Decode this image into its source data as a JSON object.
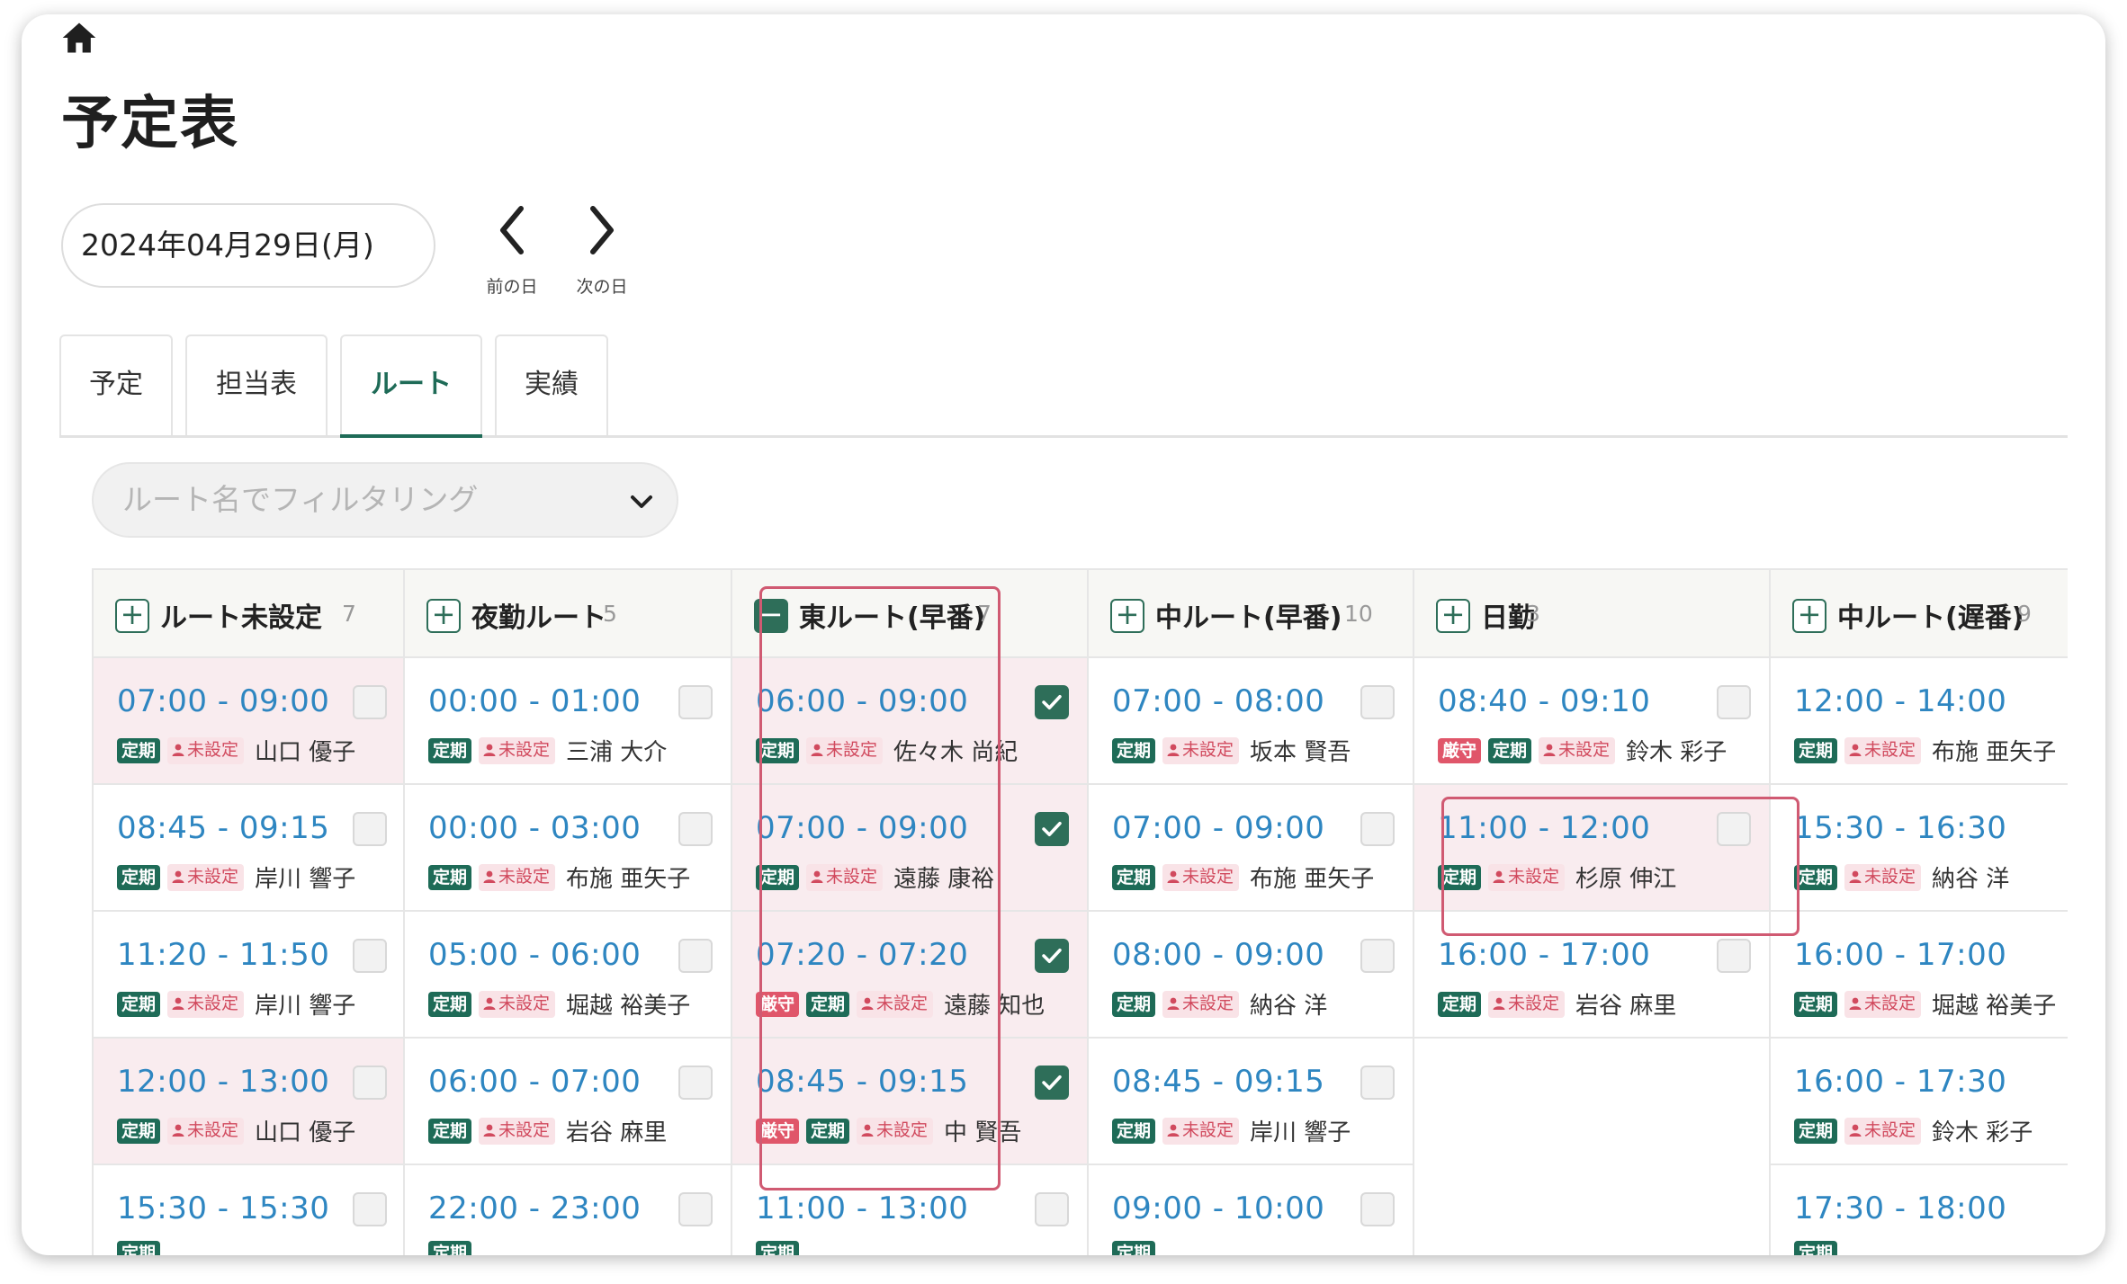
{
  "page": {
    "title": "予定表"
  },
  "date": {
    "value": "2024年04月29日(月)",
    "prev_label": "前の日",
    "next_label": "次の日"
  },
  "tabs": [
    {
      "label": "予定",
      "active": false
    },
    {
      "label": "担当表",
      "active": false
    },
    {
      "label": "ルート",
      "active": true
    },
    {
      "label": "実績",
      "active": false
    }
  ],
  "filter": {
    "placeholder": "ルート名でフィルタリング"
  },
  "colors": {
    "accent": "#1e6b57",
    "time": "#2e86c1",
    "unset": "#d14a5e",
    "highlight": "#d05a72"
  },
  "columns": [
    {
      "name": "ルート未設定",
      "count": "7",
      "expanded": false,
      "cards": [
        {
          "time": "07:00 - 09:00",
          "badges": [
            "定期"
          ],
          "status": "未設定",
          "person": "山口 優子",
          "checked": false,
          "pink": true
        },
        {
          "time": "08:45 - 09:15",
          "badges": [
            "定期"
          ],
          "status": "未設定",
          "person": "岸川 響子",
          "checked": false,
          "pink": false
        },
        {
          "time": "11:20 - 11:50",
          "badges": [
            "定期"
          ],
          "status": "未設定",
          "person": "岸川 響子",
          "checked": false,
          "pink": false
        },
        {
          "time": "12:00 - 13:00",
          "badges": [
            "定期"
          ],
          "status": "未設定",
          "person": "山口 優子",
          "checked": false,
          "pink": true
        },
        {
          "time": "15:30 - 15:30",
          "badges": [
            "定期"
          ],
          "status": "",
          "person": "",
          "checked": false,
          "pink": false
        }
      ]
    },
    {
      "name": "夜勤ルート",
      "count": "5",
      "expanded": false,
      "cards": [
        {
          "time": "00:00 - 01:00",
          "badges": [
            "定期"
          ],
          "status": "未設定",
          "person": "三浦 大介",
          "checked": false,
          "pink": false
        },
        {
          "time": "00:00 - 03:00",
          "badges": [
            "定期"
          ],
          "status": "未設定",
          "person": "布施 亜矢子",
          "checked": false,
          "pink": false
        },
        {
          "time": "05:00 - 06:00",
          "badges": [
            "定期"
          ],
          "status": "未設定",
          "person": "堀越 裕美子",
          "checked": false,
          "pink": false
        },
        {
          "time": "06:00 - 07:00",
          "badges": [
            "定期"
          ],
          "status": "未設定",
          "person": "岩谷 麻里",
          "checked": false,
          "pink": false
        },
        {
          "time": "22:00 - 23:00",
          "badges": [
            "定期"
          ],
          "status": "",
          "person": "",
          "checked": false,
          "pink": false
        }
      ]
    },
    {
      "name": "東ルート(早番)",
      "count": "7",
      "expanded": true,
      "cards": [
        {
          "time": "06:00 - 09:00",
          "badges": [
            "定期"
          ],
          "status": "未設定",
          "person": "佐々木 尚紀",
          "checked": true,
          "pink": true
        },
        {
          "time": "07:00 - 09:00",
          "badges": [
            "定期"
          ],
          "status": "未設定",
          "person": "遠藤 康裕",
          "checked": true,
          "pink": true
        },
        {
          "time": "07:20 - 07:20",
          "badges": [
            "厳守",
            "定期"
          ],
          "status": "未設定",
          "person": "遠藤 知也",
          "checked": true,
          "pink": true
        },
        {
          "time": "08:45 - 09:15",
          "badges": [
            "厳守",
            "定期"
          ],
          "status": "未設定",
          "person": "中 賢吾",
          "checked": true,
          "pink": true
        },
        {
          "time": "11:00 - 13:00",
          "badges": [
            "定期"
          ],
          "status": "",
          "person": "",
          "checked": false,
          "pink": false
        }
      ]
    },
    {
      "name": "中ルート(早番)",
      "count": "10",
      "expanded": false,
      "cards": [
        {
          "time": "07:00 - 08:00",
          "badges": [
            "定期"
          ],
          "status": "未設定",
          "person": "坂本 賢吾",
          "checked": false,
          "pink": false
        },
        {
          "time": "07:00 - 09:00",
          "badges": [
            "定期"
          ],
          "status": "未設定",
          "person": "布施 亜矢子",
          "checked": false,
          "pink": false
        },
        {
          "time": "08:00 - 09:00",
          "badges": [
            "定期"
          ],
          "status": "未設定",
          "person": "納谷 洋",
          "checked": false,
          "pink": false
        },
        {
          "time": "08:45 - 09:15",
          "badges": [
            "定期"
          ],
          "status": "未設定",
          "person": "岸川 響子",
          "checked": false,
          "pink": false
        },
        {
          "time": "09:00 - 10:00",
          "badges": [
            "定期"
          ],
          "status": "",
          "person": "",
          "checked": false,
          "pink": false
        }
      ]
    },
    {
      "name": "日勤",
      "count": "3",
      "expanded": false,
      "cards": [
        {
          "time": "08:40 - 09:10",
          "badges": [
            "厳守",
            "定期"
          ],
          "status": "未設定",
          "person": "鈴木 彩子",
          "checked": false,
          "pink": false
        },
        {
          "time": "11:00 - 12:00",
          "badges": [
            "定期"
          ],
          "status": "未設定",
          "person": "杉原 伸江",
          "checked": false,
          "pink": true
        },
        {
          "time": "16:00 - 17:00",
          "badges": [
            "定期"
          ],
          "status": "未設定",
          "person": "岩谷 麻里",
          "checked": false,
          "pink": false
        }
      ]
    },
    {
      "name": "中ルート(遅番)",
      "count": "9",
      "expanded": false,
      "cards": [
        {
          "time": "12:00 - 14:00",
          "badges": [
            "定期"
          ],
          "status": "未設定",
          "person": "布施 亜矢子",
          "checked": false,
          "pink": false
        },
        {
          "time": "15:30 - 16:30",
          "badges": [
            "定期"
          ],
          "status": "未設定",
          "person": "納谷 洋",
          "checked": false,
          "pink": false
        },
        {
          "time": "16:00 - 17:00",
          "badges": [
            "定期"
          ],
          "status": "未設定",
          "person": "堀越 裕美子",
          "checked": false,
          "pink": false
        },
        {
          "time": "16:00 - 17:30",
          "badges": [
            "定期"
          ],
          "status": "未設定",
          "person": "鈴木 彩子",
          "checked": false,
          "pink": false
        },
        {
          "time": "17:30 - 18:00",
          "badges": [
            "定期"
          ],
          "status": "",
          "person": "",
          "checked": false,
          "pink": false
        }
      ]
    }
  ]
}
